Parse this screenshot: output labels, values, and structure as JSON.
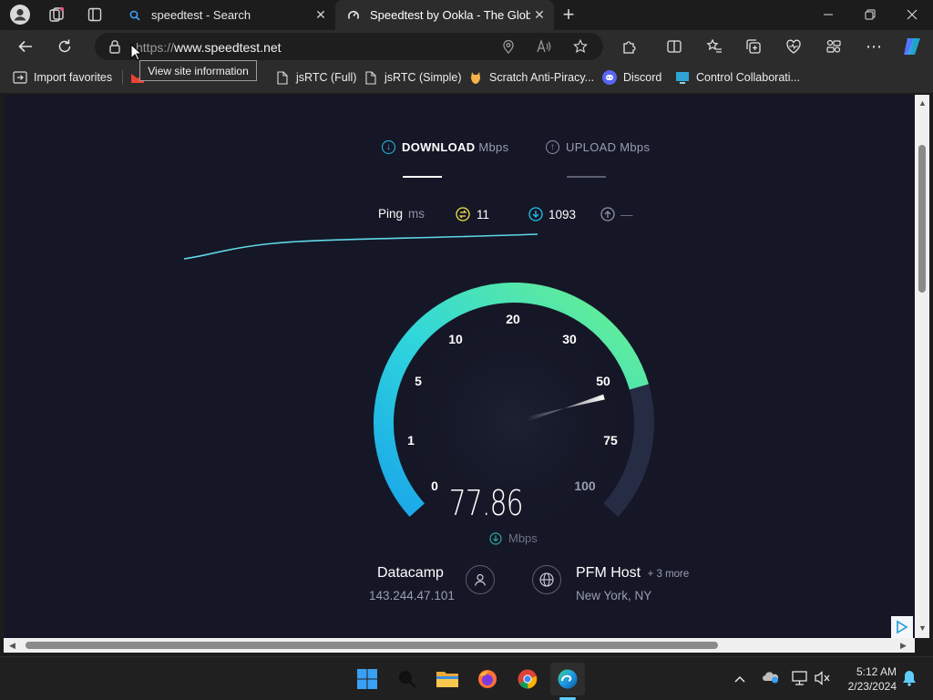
{
  "browser": {
    "tabs": [
      {
        "title": "speedtest - Search"
      },
      {
        "title": "Speedtest by Ookla - The Global Broadband Speed Test"
      }
    ],
    "new_tab_label": "+",
    "url_scheme": "https://",
    "url_host": "www.speedtest.net",
    "tooltip": "View site information",
    "favorites": [
      {
        "label": "Import favorites"
      },
      {
        "label": "jsRTC (Full)"
      },
      {
        "label": "jsRTC (Simple)"
      },
      {
        "label": "Scratch Anti-Piracy..."
      },
      {
        "label": "Discord"
      },
      {
        "label": "Control Collaborati..."
      }
    ]
  },
  "speedtest": {
    "download_label": "DOWNLOAD",
    "download_unit": "Mbps",
    "upload_label": "UPLOAD",
    "upload_unit": "Mbps",
    "ping_label": "Ping",
    "ping_unit": "ms",
    "jitter": "11",
    "download_ping": "1093",
    "upload_ping": "—",
    "gauge_labels": [
      "0",
      "1",
      "5",
      "10",
      "20",
      "30",
      "50",
      "75",
      "100"
    ],
    "current_speed": "77.86",
    "speed_unit": "Mbps",
    "gauge_progress_fraction": 0.78,
    "client_isp": "Datacamp",
    "client_ip": "143.244.47.101",
    "server_name": "PFM Host",
    "server_more": "+ 3 more",
    "server_location": "New York, NY"
  },
  "colors": {
    "page_bg": "#151726",
    "accent_cyan": "#21c4ea",
    "accent_green": "#69f08a",
    "muted_text": "#9a9cb2"
  },
  "taskbar": {
    "time": "5:12 AM",
    "date": "2/23/2024",
    "apps": [
      "start-icon",
      "search-icon",
      "file-explorer-icon",
      "firefox-icon",
      "chrome-icon",
      "edge-icon"
    ]
  }
}
